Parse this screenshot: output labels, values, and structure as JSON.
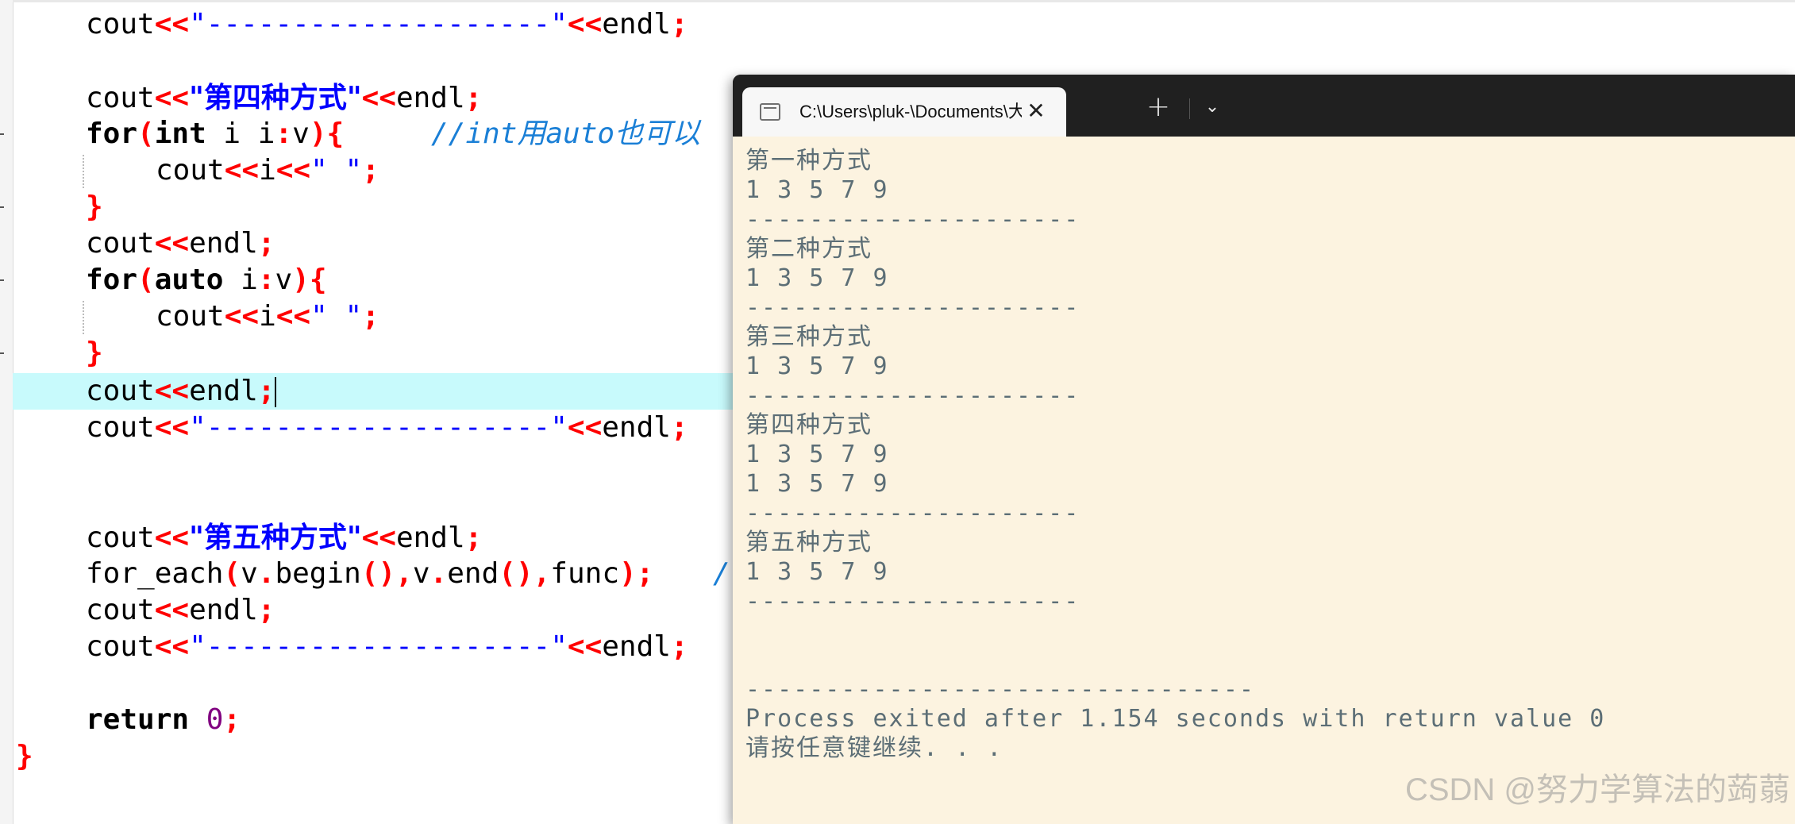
{
  "editor": {
    "lines": {
      "l1": {
        "a": "cout",
        "b": "<<",
        "c": "\"--------------------\"",
        "d": "<<",
        "e": "endl",
        "f": ";"
      },
      "l3": {
        "a": "cout",
        "b": "<<",
        "c": "\"第四种方式\"",
        "d": "<<",
        "e": "endl",
        "f": ";"
      },
      "l4": {
        "a": "for",
        "b": "(",
        "c": "int",
        " d": " i",
        "e": ":",
        "f": "v",
        "g": ")",
        "h": "{",
        "cmt": "//int用auto也可以"
      },
      "l5": {
        "a": "cout",
        "b": "<<",
        "c": "i",
        "d": "<<",
        "e": "\" \"",
        "f": ";"
      },
      "l6": {
        "a": "}"
      },
      "l7": {
        "a": "cout",
        "b": "<<",
        "c": "endl",
        "d": ";"
      },
      "l8": {
        "a": "for",
        "b": "(",
        "c": "auto",
        "d": " i",
        "e": ":",
        "f": "v",
        "g": ")",
        "h": "{"
      },
      "l9": {
        "a": "cout",
        "b": "<<",
        "c": "i",
        "d": "<<",
        "e": "\" \"",
        "f": ";"
      },
      "l10": {
        "a": "}"
      },
      "l11": {
        "a": "cout",
        "b": "<<",
        "c": "endl",
        "d": ";"
      },
      "l12": {
        "a": "cout",
        "b": "<<",
        "c": "\"--------------------\"",
        "d": "<<",
        "e": "endl",
        "f": ";"
      },
      "l15": {
        "a": "cout",
        "b": "<<",
        "c": "\"第五种方式\"",
        "d": "<<",
        "e": "endl",
        "f": ";"
      },
      "l16": {
        "a": "for_each",
        "b": "(",
        "c": "v",
        ".": ".",
        "d": "begin",
        "e": "(),",
        "f": "v",
        "g": ".",
        "h": "end",
        "i": "(),",
        "j": "func",
        "k": ");",
        "cmt": "/"
      },
      "l17": {
        "a": "cout",
        "b": "<<",
        "c": "endl",
        "d": ";"
      },
      "l18": {
        "a": "cout",
        "b": "<<",
        "c": "\"--------------------\"",
        "d": "<<",
        "e": "endl",
        "f": ";"
      },
      "l20": {
        "a": "return",
        "b": " ",
        "c": "0",
        "d": ";"
      },
      "l21": {
        "a": "}"
      }
    }
  },
  "console": {
    "tab_title": "C:\\Users\\pluk-\\Documents\\大",
    "close_glyph": "✕",
    "new_tab_glyph": "+",
    "dropdown_glyph": "⌄",
    "output": [
      "第一种方式",
      "1 3 5 7 9",
      "---------------------",
      "第二种方式",
      "1 3 5 7 9",
      "---------------------",
      "第三种方式",
      "1 3 5 7 9",
      "---------------------",
      "第四种方式",
      "1 3 5 7 9",
      "1 3 5 7 9",
      "---------------------",
      "第五种方式",
      "1 3 5 7 9",
      "---------------------",
      "",
      "",
      "--------------------------------",
      "Process exited after 1.154 seconds with return value 0",
      "请按任意键继续. . ."
    ]
  },
  "watermark": "CSDN @努力学算法的蒟蒻"
}
